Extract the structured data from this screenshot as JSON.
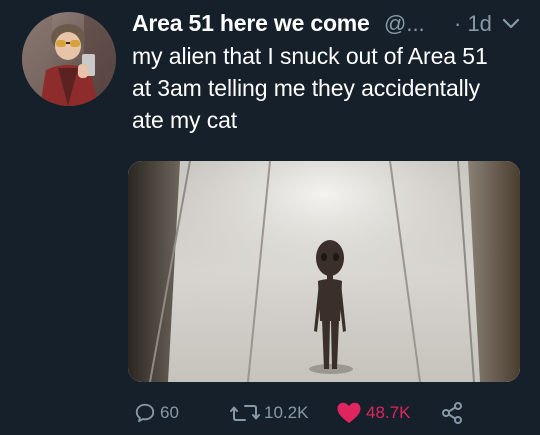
{
  "tweet": {
    "display_name": "Area 51 here we come",
    "handle": "@...",
    "timestamp": "· 1d",
    "text_lines": [
      "my alien that I snuck out of Area 51",
      "at 3am telling me they accidentally",
      "ate my cat"
    ],
    "actions": {
      "reply_count": "60",
      "retweet_count": "10.2K",
      "like_count": "48.7K",
      "liked": true
    }
  },
  "colors": {
    "background": "#15202b",
    "muted_text": "#8899a6",
    "like_red": "#e0245e"
  },
  "icons": [
    "chevron-down-icon",
    "reply-icon",
    "retweet-icon",
    "heart-icon",
    "share-icon"
  ]
}
